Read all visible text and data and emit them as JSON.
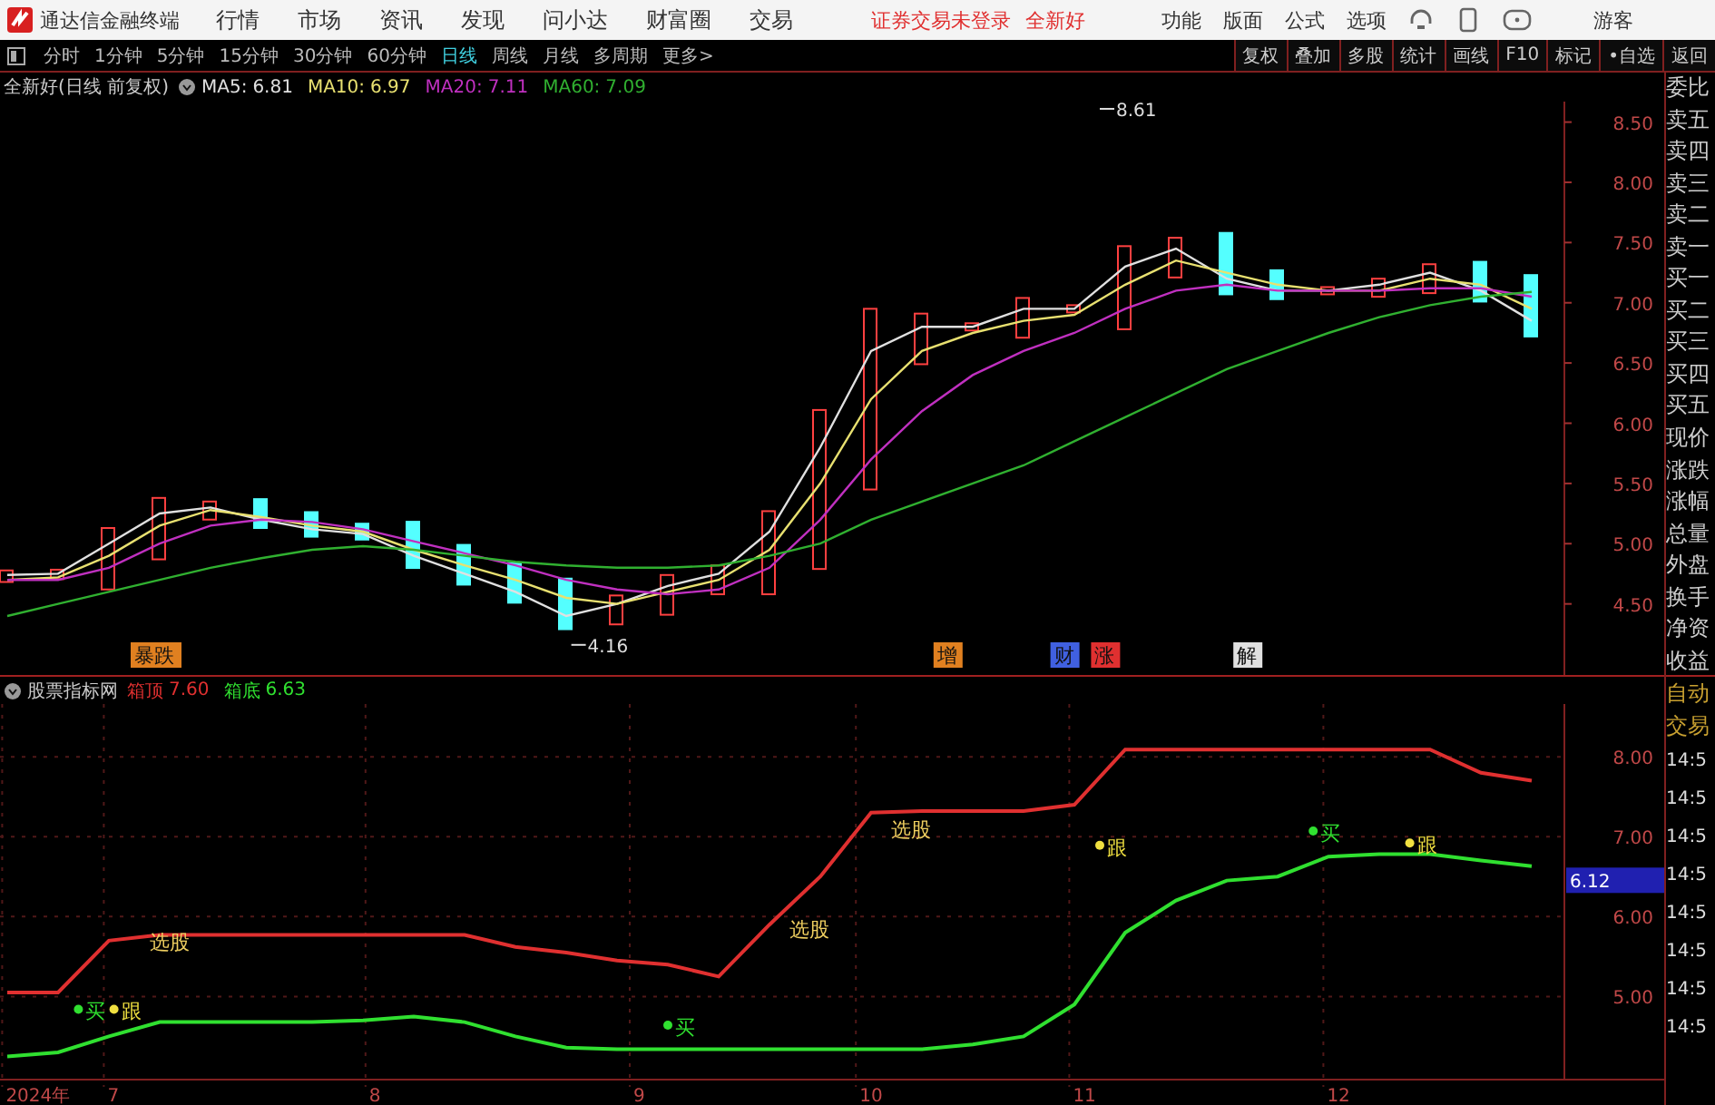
{
  "menubar": {
    "app_title": "通达信金融终端",
    "menus": [
      "行情",
      "市场",
      "资讯",
      "发现",
      "问小达",
      "财富圈",
      "交易"
    ],
    "notice": "证券交易未登录",
    "stock_name": "全新好",
    "tools": [
      "功能",
      "版面",
      "公式",
      "选项"
    ],
    "user": "游客"
  },
  "toolbar": {
    "periods": [
      {
        "label": "分时",
        "selected": false
      },
      {
        "label": "1分钟",
        "selected": false
      },
      {
        "label": "5分钟",
        "selected": false
      },
      {
        "label": "15分钟",
        "selected": false
      },
      {
        "label": "30分钟",
        "selected": false
      },
      {
        "label": "60分钟",
        "selected": false
      },
      {
        "label": "日线",
        "selected": true
      },
      {
        "label": "周线",
        "selected": false
      },
      {
        "label": "月线",
        "selected": false
      },
      {
        "label": "多周期",
        "selected": false
      },
      {
        "label": "更多>",
        "selected": false
      }
    ],
    "actions": [
      "复权",
      "叠加",
      "多股",
      "统计",
      "画线",
      "F10",
      "标记",
      "•自选",
      "返回"
    ]
  },
  "main_chart": {
    "title": "全新好(日线 前复权)",
    "legend_values": [
      "6.81",
      "6.97",
      "7.11",
      "7.09"
    ],
    "chart_data": {
      "type": "line",
      "ylim": [
        3.91,
        8.67
      ],
      "yticks": [
        {
          "value": 8.5,
          "label": "8.50"
        },
        {
          "value": 8.0,
          "label": "8.00"
        },
        {
          "value": 7.5,
          "label": "7.50"
        },
        {
          "value": 7.0,
          "label": "7.00"
        },
        {
          "value": 6.5,
          "label": "6.50"
        },
        {
          "value": 6.0,
          "label": "6.00"
        },
        {
          "value": 5.5,
          "label": "5.50"
        },
        {
          "value": 5.0,
          "label": "5.00"
        },
        {
          "value": 4.5,
          "label": "4.50"
        }
      ],
      "series": [
        {
          "name": "MA5:",
          "color": "#e0e0e0",
          "values": [
            4.74,
            4.75,
            5.0,
            5.25,
            5.3,
            5.2,
            5.12,
            5.08,
            4.9,
            4.75,
            4.6,
            4.4,
            4.5,
            4.65,
            4.75,
            5.1,
            5.8,
            6.6,
            6.8,
            6.8,
            6.95,
            6.95,
            7.3,
            7.45,
            7.2,
            7.1,
            7.1,
            7.15,
            7.25,
            7.1,
            6.85
          ]
        },
        {
          "name": "MA10:",
          "color": "#e8e070",
          "values": [
            4.7,
            4.72,
            4.9,
            5.15,
            5.28,
            5.22,
            5.15,
            5.1,
            4.95,
            4.82,
            4.7,
            4.55,
            4.5,
            4.6,
            4.7,
            4.95,
            5.5,
            6.2,
            6.6,
            6.75,
            6.85,
            6.9,
            7.15,
            7.35,
            7.25,
            7.15,
            7.1,
            7.1,
            7.2,
            7.15,
            6.95
          ]
        },
        {
          "name": "MA20:",
          "color": "#c030c0",
          "values": [
            4.7,
            4.7,
            4.8,
            5.0,
            5.15,
            5.2,
            5.18,
            5.12,
            5.02,
            4.92,
            4.82,
            4.7,
            4.62,
            4.58,
            4.62,
            4.8,
            5.2,
            5.7,
            6.1,
            6.4,
            6.6,
            6.75,
            6.95,
            7.1,
            7.15,
            7.1,
            7.1,
            7.1,
            7.12,
            7.12,
            7.05
          ]
        },
        {
          "name": "MA60:",
          "color": "#30b030",
          "values": [
            4.4,
            4.5,
            4.6,
            4.7,
            4.8,
            4.88,
            4.95,
            4.98,
            4.95,
            4.9,
            4.85,
            4.82,
            4.8,
            4.8,
            4.82,
            4.9,
            5.0,
            5.2,
            5.35,
            5.5,
            5.65,
            5.85,
            6.05,
            6.25,
            6.45,
            6.6,
            6.75,
            6.88,
            6.98,
            7.05,
            7.09
          ]
        }
      ],
      "annotations": [
        "8.61",
        "4.16"
      ]
    },
    "events": [
      {
        "text": "暴跌",
        "color": "#e08020"
      },
      {
        "text": "增",
        "color": "#e08020"
      },
      {
        "text": "财",
        "color": "#4060e0"
      },
      {
        "text": "涨",
        "color": "#e03030"
      },
      {
        "text": "解",
        "color": "#e0e0e0"
      }
    ]
  },
  "indicator_chart": {
    "title": "股票指标网",
    "legend_values": [
      "7.60",
      "6.63"
    ],
    "chart_data": {
      "type": "line",
      "grid": true,
      "ylim": [
        3.96,
        8.66
      ],
      "yticks": [
        {
          "value": 8.0,
          "label": "8.00"
        },
        {
          "value": 7.0,
          "label": "7.00"
        },
        {
          "value": 6.0,
          "label": "6.00"
        },
        {
          "value": 5.0,
          "label": "5.00"
        }
      ],
      "series": [
        {
          "name": "箱顶",
          "color": "#e03030",
          "values": [
            5.05,
            5.05,
            5.7,
            5.77,
            5.77,
            5.77,
            5.77,
            5.77,
            5.77,
            5.77,
            5.62,
            5.55,
            5.45,
            5.4,
            5.25,
            5.9,
            6.5,
            7.3,
            7.32,
            7.32,
            7.32,
            7.4,
            8.09,
            8.09,
            8.09,
            8.09,
            8.09,
            8.09,
            8.09,
            7.8,
            7.7
          ]
        },
        {
          "name": "箱底",
          "color": "#30e030",
          "values": [
            4.25,
            4.3,
            4.5,
            4.68,
            4.68,
            4.68,
            4.68,
            4.7,
            4.75,
            4.68,
            4.5,
            4.36,
            4.34,
            4.34,
            4.34,
            4.34,
            4.34,
            4.34,
            4.34,
            4.4,
            4.5,
            4.9,
            5.8,
            6.2,
            6.45,
            6.5,
            6.75,
            6.78,
            6.78,
            6.7,
            6.63
          ]
        }
      ]
    },
    "signals": [
      {
        "kind": "pick",
        "text": "选股"
      },
      {
        "kind": "pick",
        "text": "选股"
      },
      {
        "kind": "pick",
        "text": "选股"
      },
      {
        "kind": "buy",
        "text": "买"
      },
      {
        "kind": "follow",
        "text": "跟"
      },
      {
        "kind": "buy",
        "text": "买"
      },
      {
        "kind": "follow",
        "text": "跟"
      },
      {
        "kind": "buy",
        "text": "买"
      },
      {
        "kind": "follow",
        "text": "跟"
      }
    ],
    "price_tag": "6.12",
    "x_axis_labels": [
      "2024年",
      "7",
      "8",
      "9",
      "10",
      "11",
      "12"
    ]
  },
  "side_panel": {
    "quote_rows": [
      "委比",
      "卖五",
      "卖四",
      "卖三",
      "卖二",
      "卖一",
      "买一",
      "买二",
      "买三",
      "买四",
      "买五",
      "现价",
      "涨跌",
      "涨幅",
      "总量",
      "外盘",
      "换手",
      "净资",
      "收益"
    ],
    "trade_rows": [
      "自动",
      "交易"
    ],
    "times": [
      "14:5",
      "14:5",
      "14:5",
      "14:5",
      "14:5",
      "14:5",
      "14:5",
      "14:5"
    ]
  }
}
